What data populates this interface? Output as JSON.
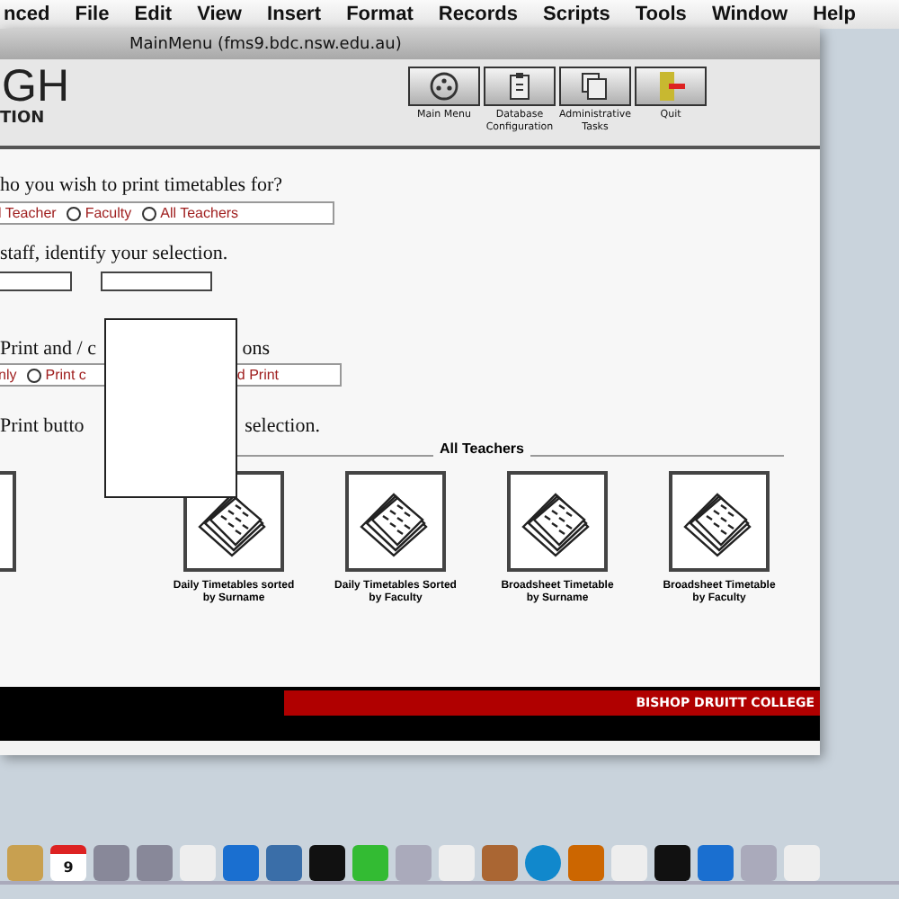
{
  "menu_bar": [
    "nced",
    "File",
    "Edit",
    "View",
    "Insert",
    "Format",
    "Records",
    "Scripts",
    "Tools",
    "Window",
    "Help"
  ],
  "window": {
    "title": "MainMenu (fms9.bdc.nsw.edu.au)"
  },
  "logo": {
    "line_1": "GH",
    "line_2": "TION"
  },
  "toolbar": [
    {
      "kind": "target",
      "label": "Main Menu"
    },
    {
      "kind": "clipboard",
      "label": "Database Configuration"
    },
    {
      "kind": "stack",
      "label": "Administrative Tasks"
    },
    {
      "kind": "exit",
      "label": "Quit"
    }
  ],
  "question_1": "ho you wish to print timetables for?",
  "print_for": [
    {
      "label": "l Teacher"
    },
    {
      "label": "Faculty",
      "selected": false
    },
    {
      "label": "All Teachers",
      "selected": false
    }
  ],
  "question_2": "staff, identify your selection.",
  "question_3": {
    "before": "Print and / c",
    "after": "ons"
  },
  "print_mode": [
    {
      "label": "nly"
    },
    {
      "label": "Print c",
      "selected": false
    },
    {
      "label": "d Print"
    }
  ],
  "question_4": {
    "before": "Print butto",
    "after": "selection."
  },
  "section": "All Teachers",
  "reports": [
    {
      "label": "Daily Timetables sorted by Surname"
    },
    {
      "label": "Daily Timetables Sorted by Faculty"
    },
    {
      "label": "Broadsheet Timetable by Surname"
    },
    {
      "label": "Broadsheet Timetable by Faculty"
    }
  ],
  "footer": "BISHOP DRUITT COLLEGE",
  "dock": [
    {
      "kind": "book"
    },
    {
      "kind": "calendar",
      "label": "9"
    },
    {
      "kind": "gear"
    },
    {
      "kind": "gear"
    },
    {
      "kind": "paper"
    },
    {
      "kind": "word"
    },
    {
      "kind": "screen"
    },
    {
      "kind": "terminal"
    },
    {
      "kind": "green"
    },
    {
      "kind": "printer"
    },
    {
      "kind": "paper"
    },
    {
      "kind": "photo"
    },
    {
      "kind": "disc"
    },
    {
      "kind": "guitar"
    },
    {
      "kind": "paper"
    },
    {
      "kind": "terminal"
    },
    {
      "kind": "word"
    },
    {
      "kind": "printer"
    },
    {
      "kind": "paper"
    }
  ]
}
